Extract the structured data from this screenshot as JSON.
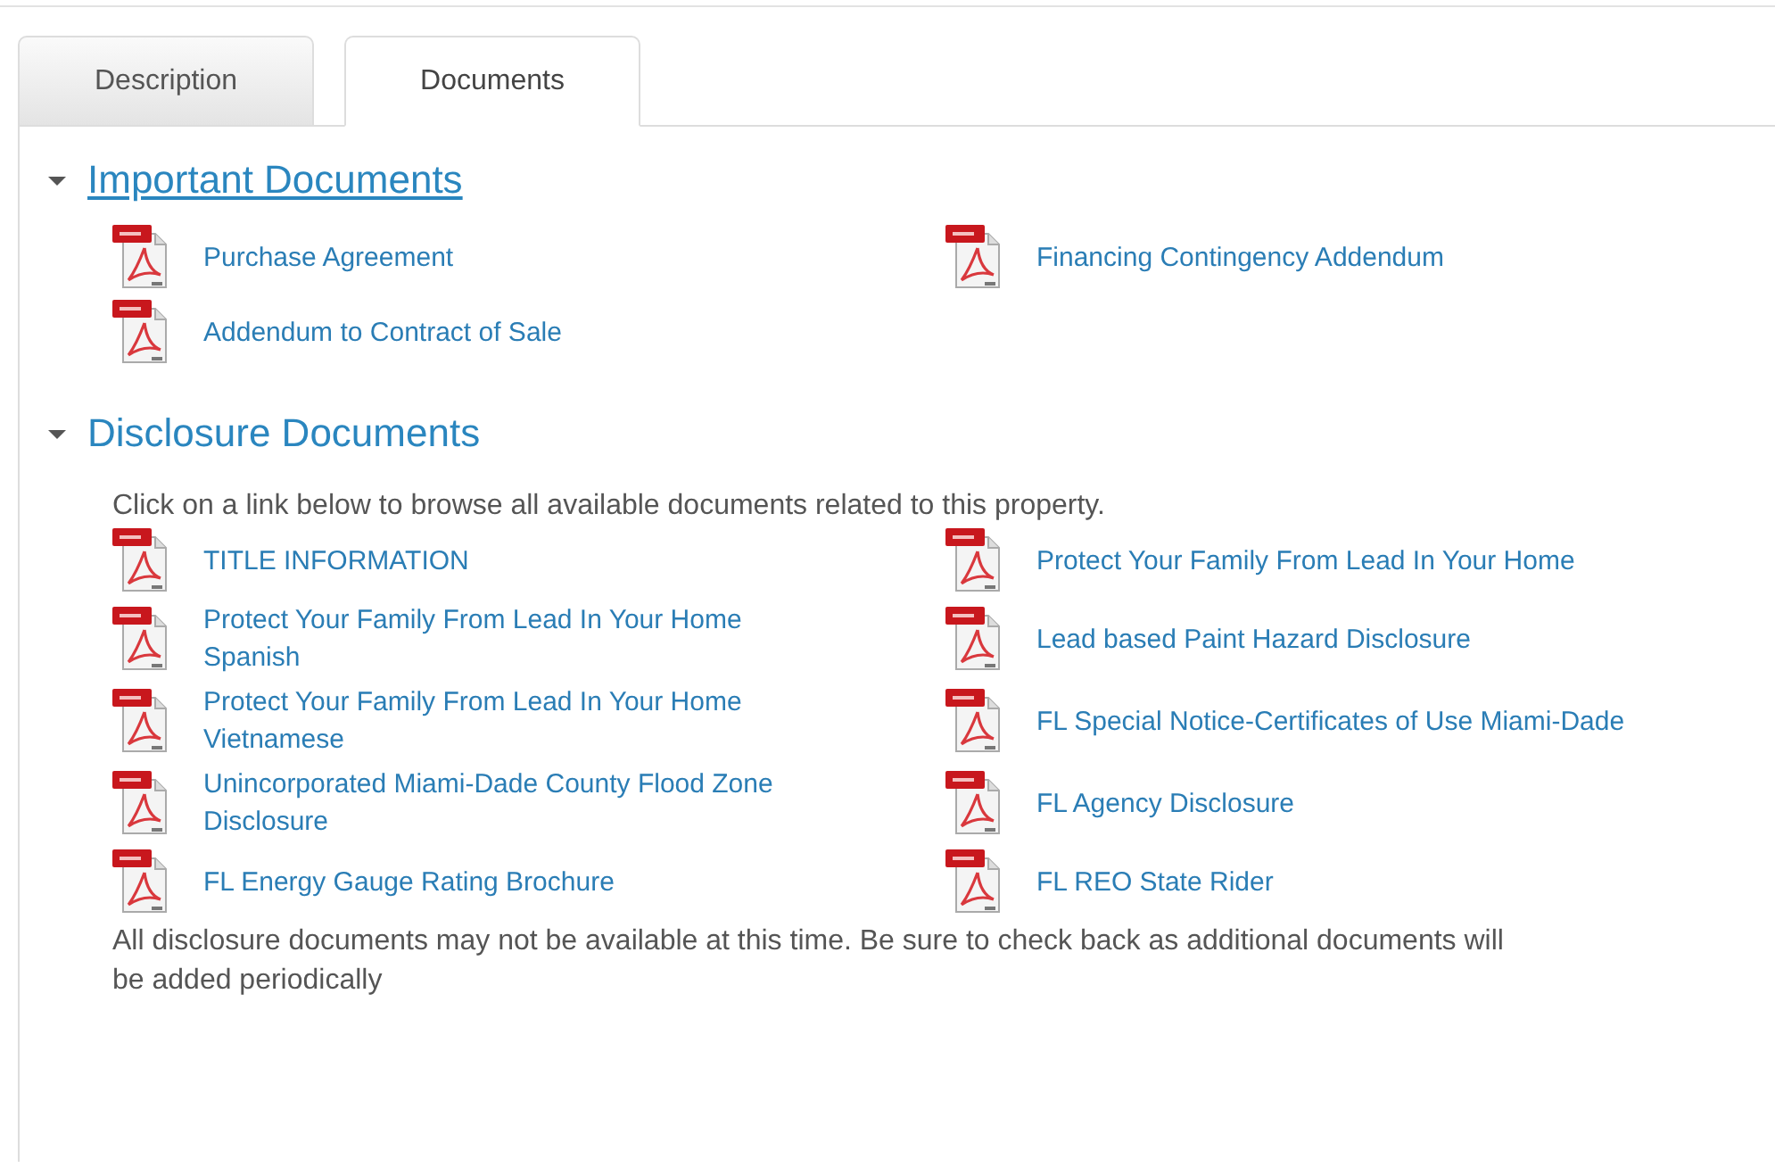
{
  "tabs": [
    {
      "label": "Description",
      "selected": false
    },
    {
      "label": "Documents",
      "selected": true
    }
  ],
  "sections": [
    {
      "title": "Important Documents",
      "expanded": true,
      "hovered": true,
      "documents": [
        {
          "label": "Purchase Agreement"
        },
        {
          "label": "Financing Contingency Addendum"
        },
        {
          "label": "Addendum to Contract of Sale"
        }
      ]
    },
    {
      "title": "Disclosure Documents",
      "expanded": true,
      "hovered": false,
      "intro": "Click on a link below to browse all available documents related to this property.",
      "documents": [
        {
          "label": "TITLE INFORMATION"
        },
        {
          "label": "Protect Your Family From Lead In Your Home"
        },
        {
          "label": "Protect Your Family From Lead In Your Home Spanish"
        },
        {
          "label": "Lead based Paint Hazard Disclosure"
        },
        {
          "label": "Protect Your Family From Lead In Your Home Vietnamese"
        },
        {
          "label": "FL Special Notice-Certificates of Use Miami-Dade"
        },
        {
          "label": "Unincorporated Miami-Dade County Flood Zone Disclosure"
        },
        {
          "label": "FL Agency Disclosure"
        },
        {
          "label": "FL Energy Gauge Rating Brochure"
        },
        {
          "label": "FL REO State Rider"
        }
      ],
      "footer": "All disclosure documents may not be available at this time. Be sure to check back as additional documents will be added periodically"
    }
  ]
}
